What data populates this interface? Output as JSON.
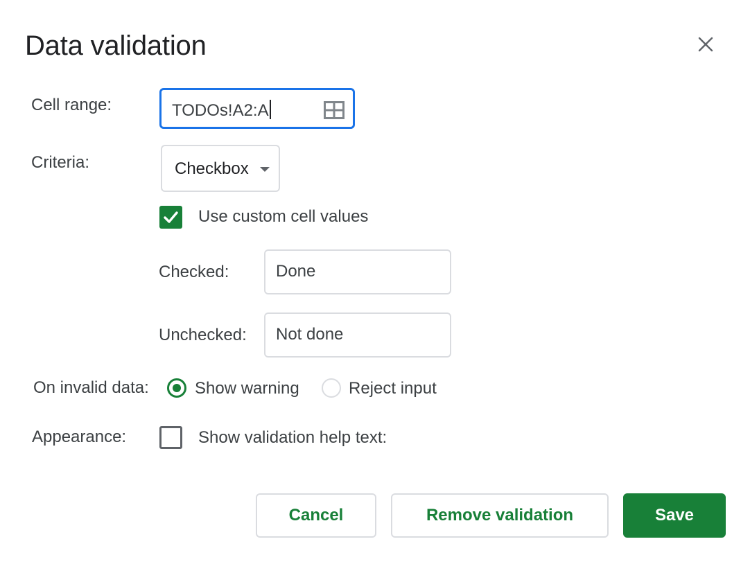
{
  "dialog": {
    "title": "Data validation",
    "close_icon": "close-icon"
  },
  "cell_range": {
    "label": "Cell range:",
    "value": "TODOs!A2:A",
    "icon": "grid-select-icon"
  },
  "criteria": {
    "label": "Criteria:",
    "selected": "Checkbox",
    "custom_values": {
      "checked": true,
      "label": "Use custom cell values"
    },
    "checked_label": "Checked:",
    "checked_value": "Done",
    "unchecked_label": "Unchecked:",
    "unchecked_value": "Not done"
  },
  "invalid_data": {
    "label": "On invalid data:",
    "options": [
      {
        "label": "Show warning",
        "selected": true
      },
      {
        "label": "Reject input",
        "selected": false
      }
    ]
  },
  "appearance": {
    "label": "Appearance:",
    "help_text": {
      "checked": false,
      "label": "Show validation help text:"
    }
  },
  "buttons": {
    "cancel": "Cancel",
    "remove": "Remove validation",
    "save": "Save"
  },
  "colors": {
    "accent_green": "#188038",
    "focus_blue": "#1a73e8",
    "border_gray": "#dadce0"
  }
}
